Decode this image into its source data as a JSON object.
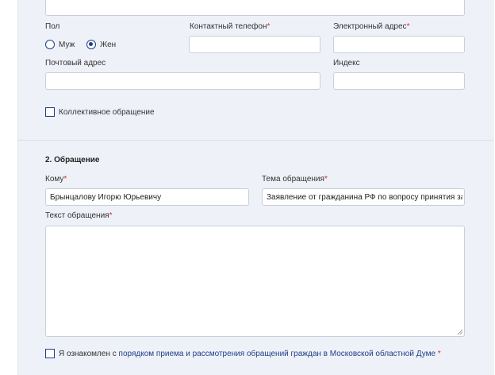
{
  "personal": {
    "gender_label": "Пол",
    "gender_male": "Муж",
    "gender_female": "Жен",
    "gender_selected": "Жен",
    "phone_label": "Контактный телефон",
    "email_label": "Электронный адрес",
    "postal_label": "Почтовый адрес",
    "index_label": "Индекс",
    "collective_label": "Коллективное обращение",
    "required_mark": "*"
  },
  "appeal": {
    "section_title": "2. Обращение",
    "to_label": "Кому",
    "to_value": "Брынцалову Игорю Юрьевичу",
    "topic_label": "Тема обращения",
    "topic_value": "Заявление от гражданина РФ по вопросу принятия за",
    "text_label": "Текст обращения",
    "text_value": ""
  },
  "consent": {
    "prefix": "Я ознакомлен с ",
    "link_text": "порядком приема и рассмотрения обращений граждан в Московской областной Думе",
    "required_mark": "*"
  },
  "colors": {
    "accent": "#1f3f8a",
    "required": "#d32f2f",
    "panel_bg": "#eef1f7"
  }
}
